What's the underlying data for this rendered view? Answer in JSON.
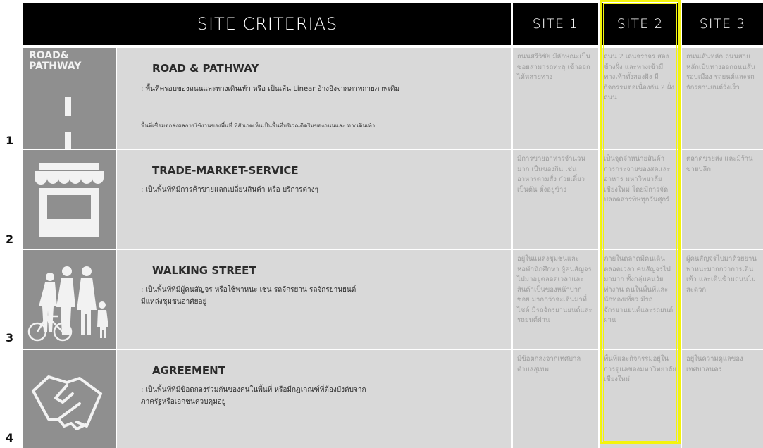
{
  "header": {
    "criteria_title": "SITE CRITERIAS",
    "site1": "SITE 1",
    "site2": "SITE 2",
    "site3": "SITE 3"
  },
  "rows": [
    {
      "number": "1",
      "icon": "road-icon",
      "icon_label_line1": "ROAD&",
      "icon_label_line2": "PATHWAY",
      "title": "ROAD & PATHWAY",
      "desc_line1": ": พื้นที่ครอบของถนนและทางเดินเท้า หรือ เป็นเส้น Linear อ้างอิงจากภาพกายภาพเดิม",
      "note": "พื้นที่เชื่อมต่อส่งผลการใช้งานของพื้นที่ ที่สังเกตเห็นเป็นพื้นที่บริเวณติดริมของถนนและ ทางเดินเท้า",
      "site1": "ถนนศรีวิชัย มีลักษณะเป็นซอยสามารถทะลุ เข้าออกได้หลายทาง",
      "site2": "ถนน 2 เลนจราจร สองข้างฝั่ง และทางเข้ามีทางเท้าทั้งสองฝั่ง มีกิจกรรมต่อเนื่องกัน 2 ฝั่งถนน",
      "site3": "ถนนเส้นหลัก ถนนสายหลักเป็นทางออกถนนสันรอบเมือง รถยนต์และรถจักรยานยนต์วิ่งเร็ว"
    },
    {
      "number": "2",
      "icon": "market-stall-icon",
      "title": "TRADE-MARKET-SERVICE",
      "desc_line1": ": เป็นพื้นที่ที่มีการค้าขายแลกเปลี่ยนสินค้า หรือ บริการต่างๆ",
      "site1": "มีการขายอาหารจำนวนมาก เป็นของกิน เช่น อาหารตามสั่ง ก๋วยเตี๋ยว เป็นต้น ตั้งอยู่ข้าง",
      "site2": "เป็นจุดจำหน่ายสินค้า การกระจายของสดและอาหาร มหาวิทยาลัยเชียงใหม่ โดยมีการจัดปลอดสารพิษทุกวันศุกร์",
      "site3": "ตลาดขายส่ง และมีร้านขายปลีก"
    },
    {
      "number": "3",
      "icon": "walking-people-icon",
      "title": "WALKING STREET",
      "desc_line1": ": เป็นพื้นที่ที่มีผู้คนสัญจร หรือใช้พาหนะ เช่น รถจักรยาน รถจักรยานยนต์",
      "desc_line2": "มีแหล่งชุมชนอาศัยอยู่",
      "site1": "อยู่ในแหล่งชุมชนและหอพักนักศึกษา ผู้คนสัญจรไปมาอยู่ตลอดเวลาและสินค้าเป็นของหน้าปากซอย มากกว่าจะเดินมาที่ไซต์ มีรถจักรยานยนต์และรถยนต์ผ่าน",
      "site2": "ภายในตลาดมีคนเดินตลอดเวลา คนสัญจรไปมามาก ทั้งกลุ่มคนวัยทำงาน คนในพื้นที่และนักท่องเที่ยว มีรถจักรยานยนต์และรถยนต์ผ่าน",
      "site3": "ผู้คนสัญจรไปมาด้วยยานพาหนะมากกว่าการเดินเท้า และเดินข้ามถนนไม่สะดวก"
    },
    {
      "number": "4",
      "icon": "handshake-icon",
      "title": "AGREEMENT",
      "desc_line1": ": เป็นพื้นที่ที่มีข้อตกลงร่วมกันของคนในพื้นที่ หรือมีกฎเกณฑ์ที่ต้องบังคับจาก",
      "desc_line2": "ภาครัฐหรือเอกชนควบคุมอยู่",
      "site1": "มีข้อตกลงจากเทศบาลตำบลสุเทพ",
      "site2": "พื้นที่และกิจกรรมอยู่ในการดูแลของมหาวิทยาลัยเชียงใหม่",
      "site3": "อยู่ในความดูแลของเทศบาลนคร"
    }
  ],
  "colors": {
    "highlight": "#f4f40c",
    "header_bg": "#000000",
    "icon_bg": "#8f8f8f",
    "criteria_bg": "#d9d9d9"
  }
}
